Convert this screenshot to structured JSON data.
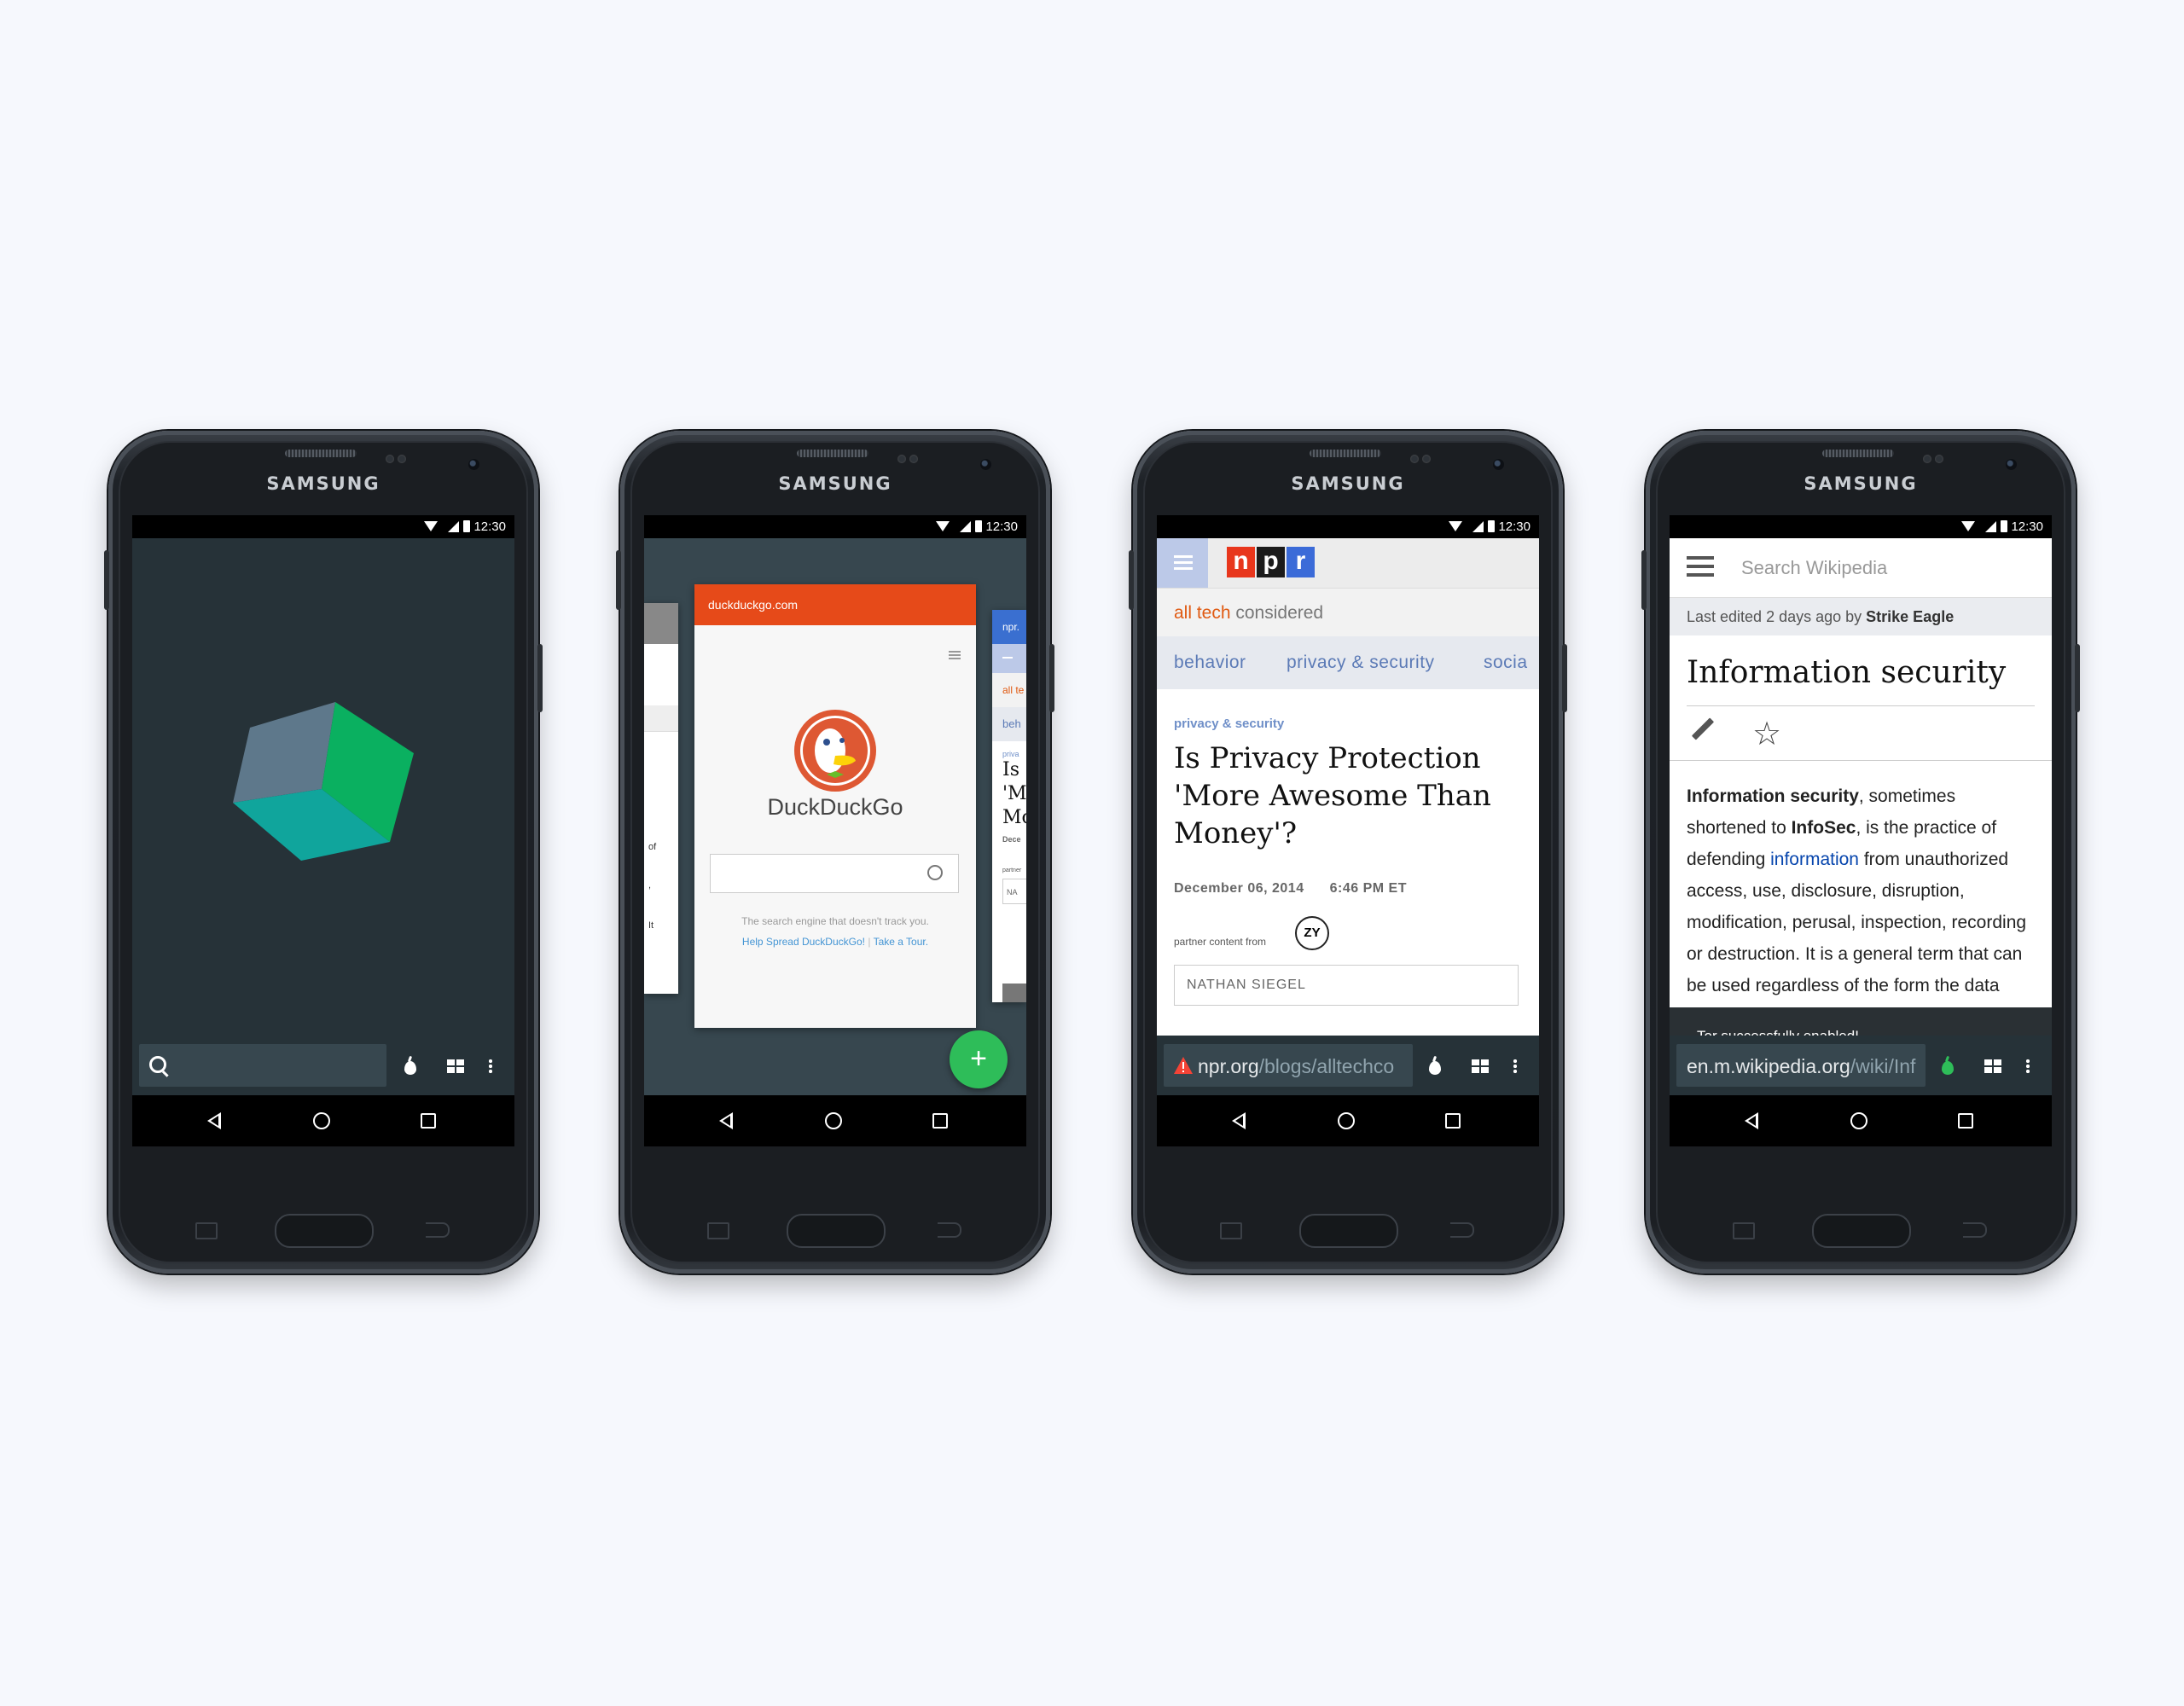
{
  "device": {
    "brand": "SAMSUNG",
    "time": "12:30"
  },
  "phone1": {
    "cube_colors": {
      "top": "#5e788b",
      "right": "#0ab060",
      "left": "#10a59c"
    }
  },
  "phone2": {
    "card_url": "duckduckgo.com",
    "ddg_name": "DuckDuckGo",
    "ddg_tagline": "The search engine that doesn't track you.",
    "ddg_link1": "Help Spread DuckDuckGo!",
    "ddg_link2": "Take a Tour.",
    "left_card_snips": [
      "of",
      ",",
      "It"
    ],
    "right_card": {
      "url": "npr.",
      "sub": "all te",
      "cat": "beh",
      "kicker": "priva",
      "title_lines": [
        "Is",
        "'M",
        "Mo"
      ],
      "date": "Dece",
      "partner": "partner",
      "author": "NA"
    },
    "fab_label": "+"
  },
  "phone3": {
    "logo_letters": [
      "n",
      "p",
      "r"
    ],
    "logo_colors": [
      "#e8361c",
      "#1b1b1b",
      "#3b6bd8"
    ],
    "subtitle_highlight": "all tech",
    "subtitle_rest": " considered",
    "categories": [
      "behavior",
      "privacy & security",
      "socia"
    ],
    "kicker": "privacy & security",
    "title": "Is Privacy Protection 'More Awesome Than Money'?",
    "date": "December 06, 2014",
    "time": "6:46 PM ET",
    "partner_label": "partner content from",
    "partner_logo": "ZY",
    "author": "NATHAN SIEGEL",
    "url_host": "npr.org",
    "url_path": "/blogs/alltechco"
  },
  "phone4": {
    "search_placeholder": "Search Wikipedia",
    "last_edited_prefix": "Last edited 2 days ago by ",
    "last_edited_user": "Strike Eagle",
    "title": "Information security",
    "body": {
      "b1": "Information security",
      "t1": ", sometimes shortened to ",
      "b2": "InfoSec",
      "t2": ", is the practice of defending ",
      "link": "information",
      "t3": " from unauthorized access, use, disclosure, disruption, modification, perusal, inspection, recording or destruction. It is a general term that can be used regardless of the form the data may"
    },
    "snackbar": "Tor successfully enabled!",
    "url_host": "en.m.wikipedia.org",
    "url_path": "/wiki/Inf",
    "onion_color": "#2ebd59"
  }
}
